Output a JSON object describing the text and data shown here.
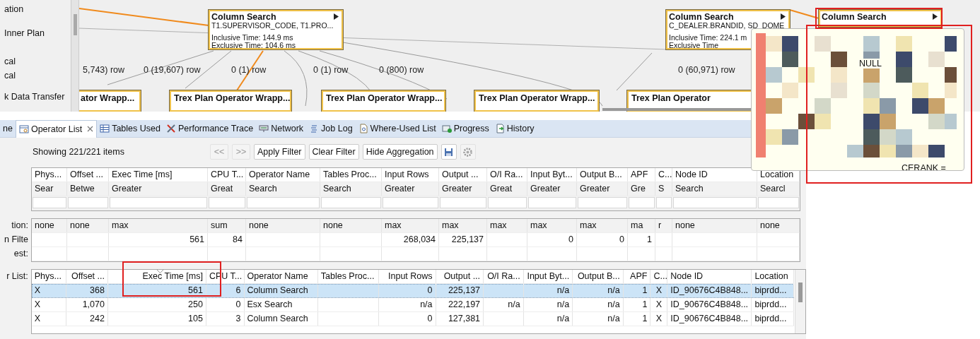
{
  "sidebar": {
    "items": [
      "ation",
      "Inner Plan",
      "cal",
      "cal",
      "k Data Transfer"
    ]
  },
  "plan_graph": {
    "nodes": [
      {
        "title": "Column Search",
        "lines": [
          "T1.SUPERVISOR_CODE, T1.PRO...",
          "Inclusive Time: 144.9 ms",
          "Exclusive Time: 104.6 ms"
        ]
      },
      {
        "title": "Column Search",
        "lines": [
          "C_DEALER.BRANDID, SD_DOME",
          "Inclusive Time: 224.1 m",
          "Exclusive Time"
        ]
      },
      {
        "title": "Column Search"
      }
    ],
    "edge_labels": [
      "5,743) row",
      "0 (19,607) row",
      "0 (1) row",
      "0 (1) row",
      "0 (800) row",
      "0 (60,971) row"
    ],
    "operator_nodes": [
      "ator Wrapp...",
      "Trex Plan Operator Wrapp...",
      "Trex Plan Operator Wrapp...",
      "Trex Plan Operator Wrapp...",
      "Trex Plan Operator"
    ]
  },
  "tooltip": {
    "fragments": [
      "NULL",
      "CERANK ="
    ]
  },
  "tabs": [
    {
      "label": "ne",
      "kind": "none",
      "selected": false
    },
    {
      "label": "Operator List",
      "kind": "table",
      "selected": true
    },
    {
      "label": "Tables Used",
      "kind": "grid",
      "selected": false
    },
    {
      "label": "Performance Trace",
      "kind": "tools",
      "selected": false
    },
    {
      "label": "Network",
      "kind": "network",
      "selected": false
    },
    {
      "label": "Job Log",
      "kind": "log",
      "selected": false
    },
    {
      "label": "Where-Used List",
      "kind": "document",
      "selected": false
    },
    {
      "label": "Progress",
      "kind": "progress",
      "selected": false
    },
    {
      "label": "History",
      "kind": "history",
      "selected": false
    }
  ],
  "toolbar": {
    "status": "Showing 221/221 items",
    "buttons": [
      {
        "label": "<<",
        "disabled": true
      },
      {
        "label": ">>",
        "disabled": true
      },
      {
        "label": "Apply Filter",
        "disabled": false
      },
      {
        "label": "Clear Filter",
        "disabled": false
      },
      {
        "label": "Hide Aggregation",
        "disabled": false
      }
    ],
    "icon_buttons": [
      {
        "kind": "save",
        "disabled": false
      },
      {
        "kind": "settings",
        "disabled": true
      }
    ]
  },
  "filter_table": {
    "columns": [
      "Phys...",
      "Offset ...",
      "Exec Time [ms]",
      "CPU T...",
      "Operator Name",
      "Tables Proc...",
      "Input Rows",
      "Output ...",
      "O/I Ra...",
      "Input Byt...",
      "Output B...",
      "APF",
      "C...",
      "Node ID",
      "Location"
    ],
    "filters": [
      "Sear",
      "Betwe",
      "Greater",
      "Great",
      "Search",
      "Search",
      "Greater",
      "Greater",
      "Great",
      "Greater",
      "Greater",
      "Gre",
      "S",
      "Search",
      "Searcl"
    ]
  },
  "aggregation": {
    "labels": [
      "tion:",
      "n Filte",
      "est:"
    ],
    "columns": [
      {
        "function": "none"
      },
      {
        "function": "none"
      },
      {
        "function": "max",
        "value": "561"
      },
      {
        "function": "sum",
        "value": "84"
      },
      {
        "function": "none"
      },
      {
        "function": "none"
      },
      {
        "function": "max",
        "value": "268,034"
      },
      {
        "function": "max",
        "value": "225,137"
      },
      {
        "function": "max"
      },
      {
        "function": "max",
        "value": "0"
      },
      {
        "function": "max",
        "value": "0"
      },
      {
        "function": "ma",
        "value": "1"
      },
      {
        "function": "r"
      },
      {
        "function": "none"
      },
      {
        "function": "none"
      }
    ]
  },
  "operator_list": {
    "label": "r List:",
    "columns": [
      {
        "label": "Phys...",
        "kind": "text",
        "sorted": false
      },
      {
        "label": "Offset ...",
        "kind": "number",
        "sorted": false
      },
      {
        "label": "Exec Time [ms]",
        "kind": "number",
        "sorted": true
      },
      {
        "label": "CPU T...",
        "kind": "number",
        "sorted": false
      },
      {
        "label": "Operator Name",
        "kind": "text",
        "sorted": false
      },
      {
        "label": "Tables Proc...",
        "kind": "text",
        "sorted": false
      },
      {
        "label": "Input Rows",
        "kind": "number",
        "sorted": false
      },
      {
        "label": "Output ...",
        "kind": "number",
        "sorted": false
      },
      {
        "label": "O/I Ra...",
        "kind": "number",
        "sorted": false
      },
      {
        "label": "Input Byt...",
        "kind": "number",
        "sorted": false
      },
      {
        "label": "Output B...",
        "kind": "number",
        "sorted": false
      },
      {
        "label": "APF",
        "kind": "number",
        "sorted": false
      },
      {
        "label": "C...",
        "kind": "center",
        "sorted": false
      },
      {
        "label": "Node ID",
        "kind": "text",
        "sorted": false
      },
      {
        "label": "Location",
        "kind": "text",
        "sorted": false
      }
    ],
    "rows": [
      {
        "selected": true,
        "cells": [
          "X",
          "368",
          "561",
          "6",
          "Column Search",
          null,
          "0",
          "225,137",
          null,
          "n/a",
          "n/a",
          "1",
          "X",
          "ID_90676C4B848...",
          "biprdd..."
        ]
      },
      {
        "selected": false,
        "cells": [
          "X",
          "1,070",
          "250",
          "0",
          "Esx Search",
          null,
          "n/a",
          "222,197",
          "n/a",
          "n/a",
          "n/a",
          "1",
          "X",
          "ID_90676C4B848...",
          "biprdd..."
        ]
      },
      {
        "selected": false,
        "cells": [
          "X",
          "242",
          "105",
          "3",
          "Column Search",
          null,
          "0",
          "127,381",
          null,
          "n/a",
          "n/a",
          "1",
          "X",
          "ID_90676C4B848...",
          "biprdd..."
        ]
      }
    ]
  }
}
